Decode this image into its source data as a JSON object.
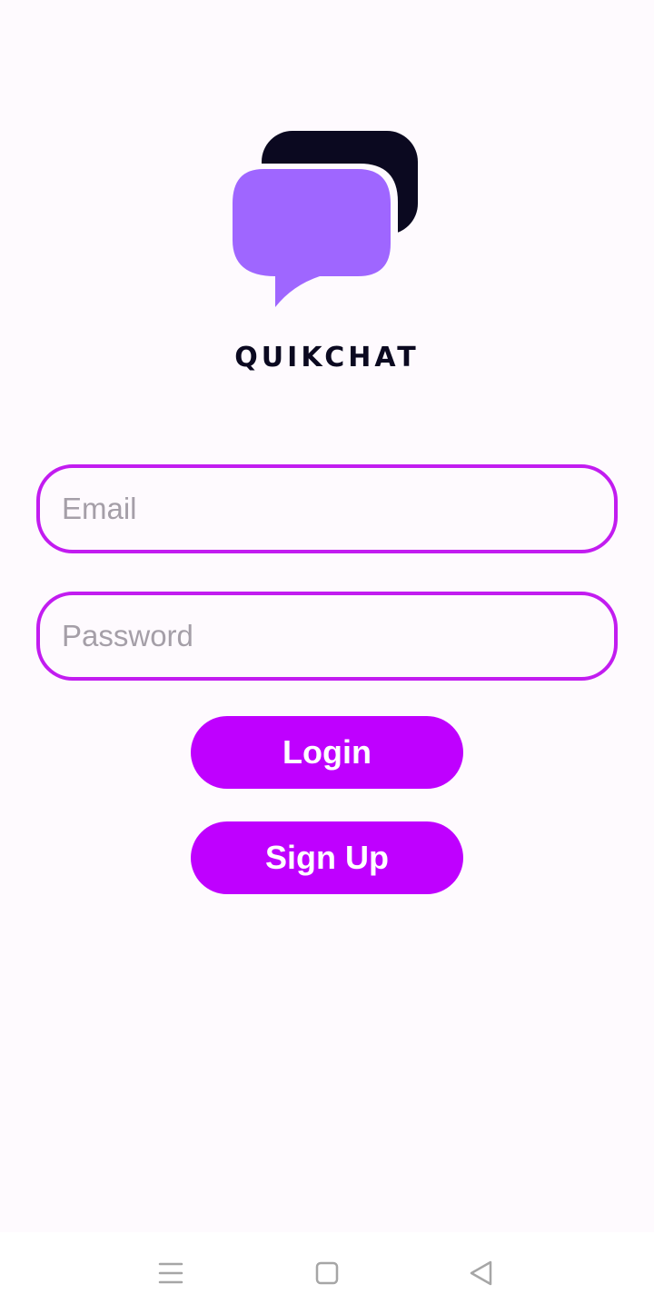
{
  "app": {
    "name": "QUIKCHAT"
  },
  "login_form": {
    "email_placeholder": "Email",
    "email_value": "",
    "password_placeholder": "Password",
    "password_value": "",
    "login_label": "Login",
    "signup_label": "Sign Up"
  },
  "navigation_bar": {
    "menu_icon": "menu-icon",
    "home_icon": "home-square-icon",
    "back_icon": "back-triangle-icon"
  },
  "colors": {
    "background": "#fefafe",
    "accent": "#bf00ff",
    "field_border": "#c21cf0",
    "logo_dark": "#0b0920",
    "logo_purple": "#9f66ff",
    "placeholder": "#a59fa8"
  }
}
